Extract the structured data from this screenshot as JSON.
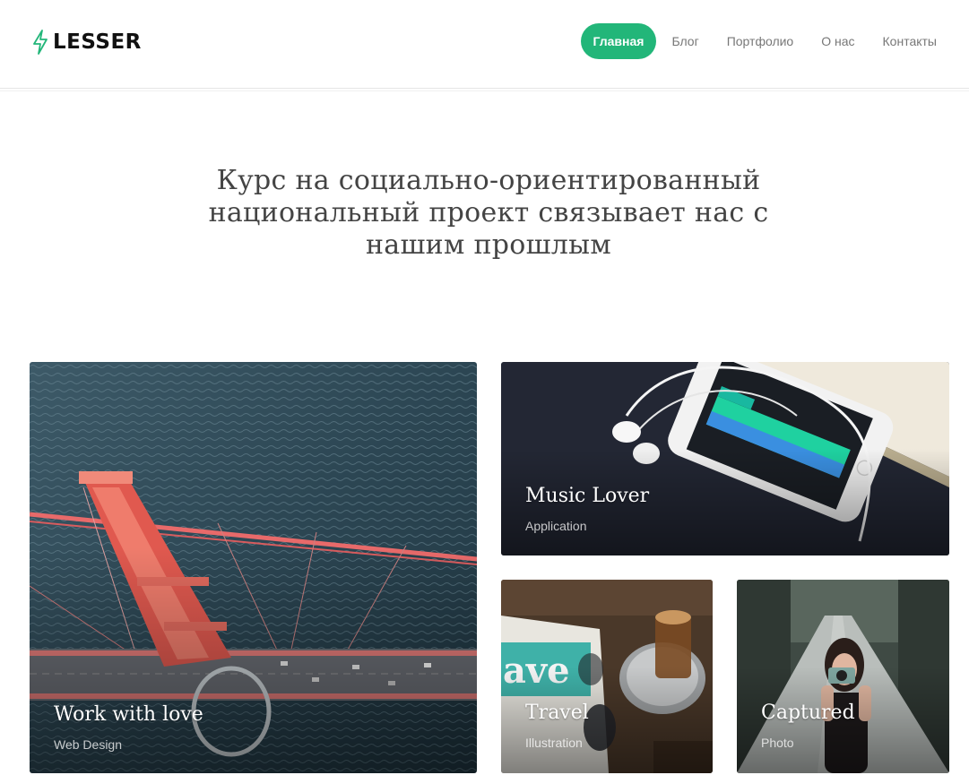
{
  "header": {
    "logo_text": "LESSER",
    "logo_icon": "lightning-bolt-icon",
    "accent_color": "#22b679",
    "nav": [
      {
        "label": "Главная",
        "active": true
      },
      {
        "label": "Блог",
        "active": false
      },
      {
        "label": "Портфолио",
        "active": false
      },
      {
        "label": "О нас",
        "active": false
      },
      {
        "label": "Контакты",
        "active": false
      }
    ]
  },
  "hero": {
    "title": "Курс на социально-ориентированный национальный проект связывает нас с нашим прошлым"
  },
  "portfolio": [
    {
      "title": "Work with love",
      "category": "Web Design"
    },
    {
      "title": "Music Lover",
      "category": "Application"
    },
    {
      "title": "Travel",
      "category": "Illustration"
    },
    {
      "title": "Captured",
      "category": "Photo"
    }
  ]
}
